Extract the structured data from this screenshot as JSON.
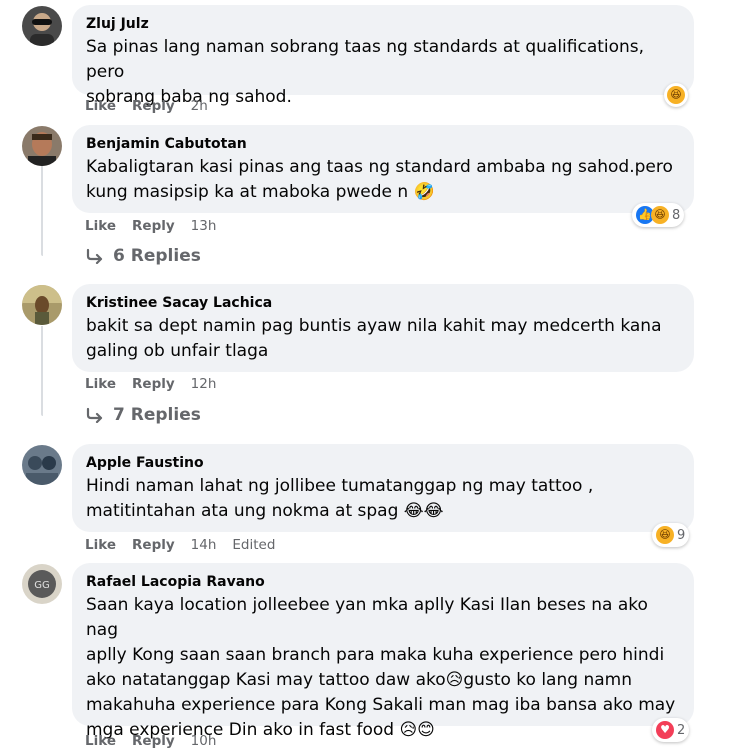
{
  "comments": [
    {
      "author": "Zluj Julz",
      "text_lines": [
        "Sa pinas lang naman sobrang taas ng standards at qualifications, pero",
        "sobrang baba ng sahod."
      ],
      "like": "Like",
      "reply": "Reply",
      "time": "2h",
      "edited": "",
      "reactions": [
        "haha"
      ],
      "reaction_count": "",
      "replies": ""
    },
    {
      "author": "Benjamin Cabutotan",
      "text_lines": [
        "Kabaligtaran kasi pinas ang taas ng standard ambaba ng sahod.pero",
        "kung masipsip ka at maboka pwede n 🤣"
      ],
      "like": "Like",
      "reply": "Reply",
      "time": "13h",
      "edited": "",
      "reactions": [
        "like",
        "haha"
      ],
      "reaction_count": "8",
      "replies": "6 Replies"
    },
    {
      "author": "Kristinee Sacay Lachica",
      "text_lines": [
        "bakit sa dept namin pag buntis ayaw nila kahit may medcerth kana",
        "galing ob unfair tlaga"
      ],
      "like": "Like",
      "reply": "Reply",
      "time": "12h",
      "edited": "",
      "reactions": [],
      "reaction_count": "",
      "replies": "7 Replies"
    },
    {
      "author": "Apple Faustino",
      "text_lines": [
        "Hindi naman lahat ng jollibee tumatanggap ng may tattoo ,",
        "matitintahan ata ung nokma at spag 😂😂"
      ],
      "like": "Like",
      "reply": "Reply",
      "time": "14h",
      "edited": "Edited",
      "reactions": [
        "haha"
      ],
      "reaction_count": "9",
      "replies": ""
    },
    {
      "author": "Rafael Lacopia Ravano",
      "text_lines": [
        "Saan kaya location jolleebee yan mka aplly Kasi Ilan beses na ako nag",
        "aplly Kong saan saan branch para maka kuha experience pero hindi",
        "ako natatanggap Kasi may tattoo daw ako😥gusto ko lang namn",
        "makahuha experience para Kong Sakali man mag iba bansa ako may",
        "mga experience Din ako in fast food 😥😊"
      ],
      "like": "Like",
      "reply": "Reply",
      "time": "10h",
      "edited": "",
      "reactions": [
        "heart"
      ],
      "reaction_count": "2",
      "replies": ""
    }
  ],
  "icons": {
    "reply_arrow": "reply-arrow-icon",
    "haha": "haha-reaction-icon",
    "like": "like-reaction-icon",
    "heart": "heart-reaction-icon"
  }
}
